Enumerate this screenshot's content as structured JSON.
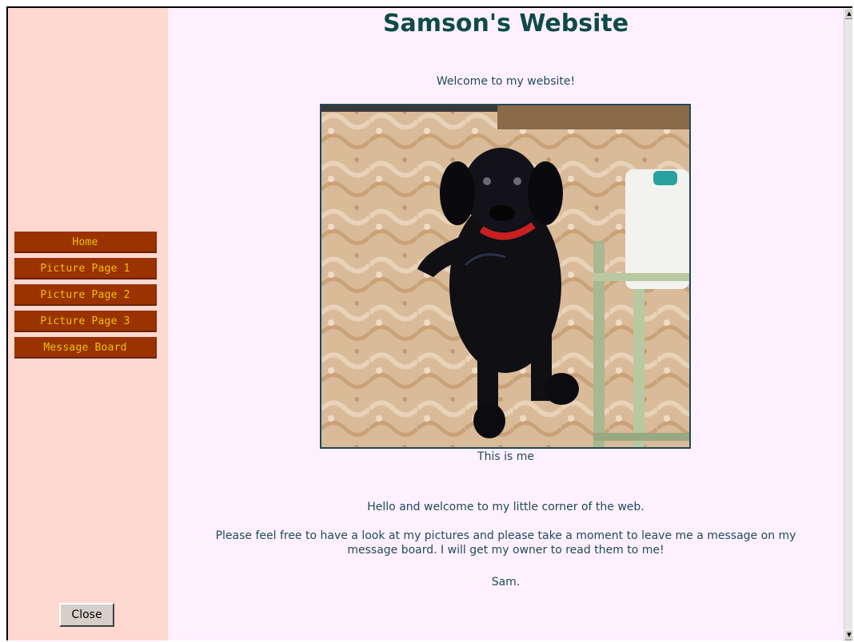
{
  "sidebar": {
    "nav_items": [
      {
        "label": "Home"
      },
      {
        "label": "Picture Page 1"
      },
      {
        "label": "Picture Page 2"
      },
      {
        "label": "Picture Page 3"
      },
      {
        "label": "Message Board"
      }
    ],
    "close_label": "Close"
  },
  "main": {
    "title": "Samson's Website",
    "welcome": "Welcome to my website!",
    "caption": "This is me",
    "paragraphs": [
      "Hello and welcome to my little corner of the web.",
      "Please feel free to have a look at my pictures and please take a moment to leave me a message on my message board. I will get my owner to read them to me!",
      "Sam."
    ]
  },
  "colors": {
    "sidebar_bg": "#ffd8d0",
    "main_bg": "#fff0ff",
    "nav_button_bg": "#9a3300",
    "nav_button_text": "#f0c000",
    "title_color": "#0d4a4a",
    "text_color": "#1e4a5a"
  },
  "icons": {
    "scroll_up": "scroll-up-arrow-icon",
    "scroll_down": "scroll-down-arrow-icon"
  }
}
